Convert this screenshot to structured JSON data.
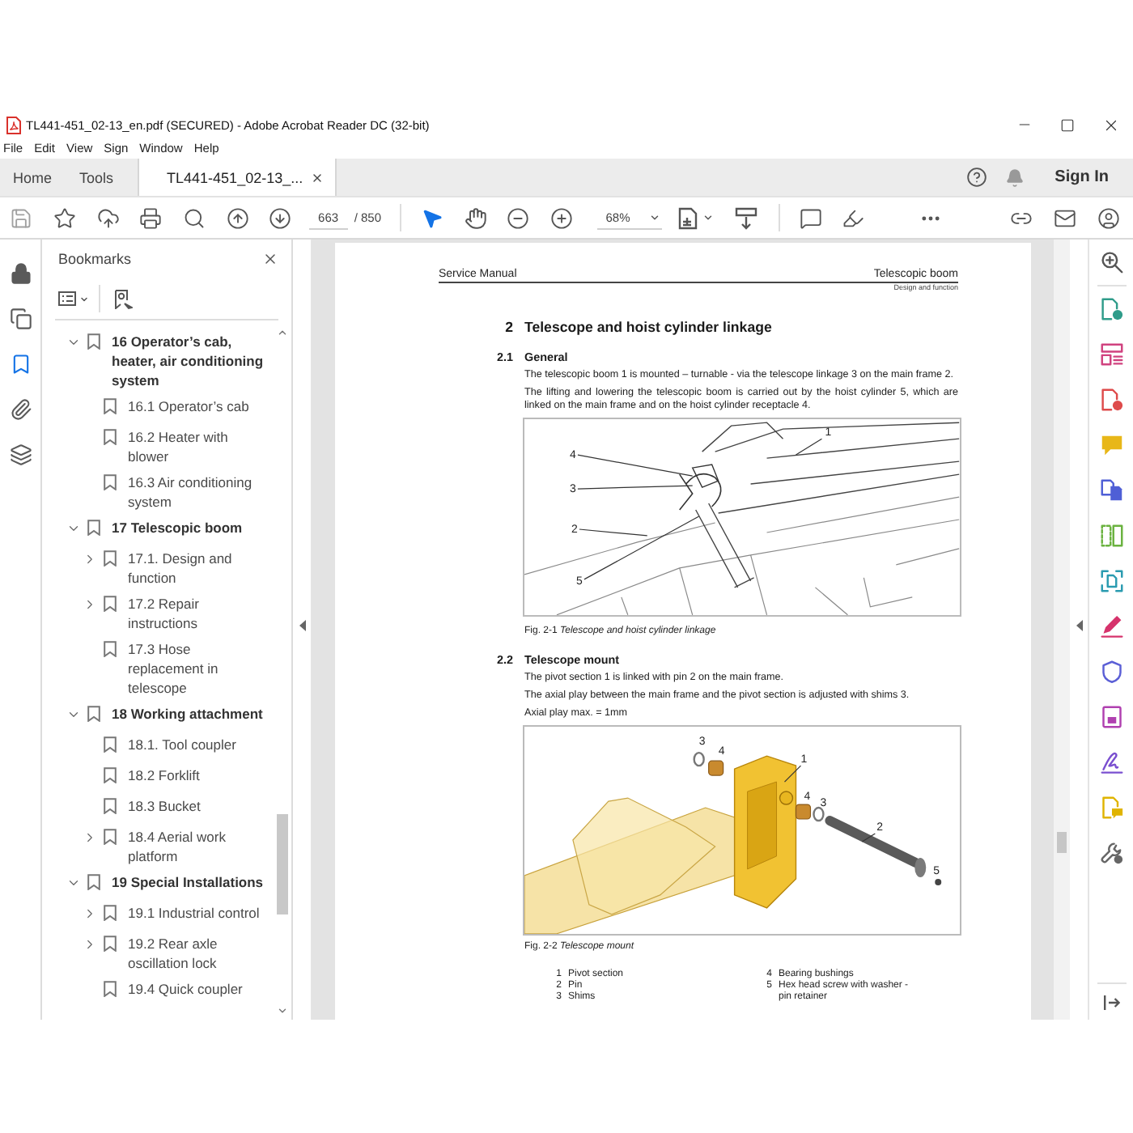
{
  "window": {
    "title": "TL441-451_02-13_en.pdf (SECURED) - Adobe Acrobat Reader DC (32-bit)"
  },
  "menu": [
    "File",
    "Edit",
    "View",
    "Sign",
    "Window",
    "Help"
  ],
  "tabs": [
    {
      "label": "Home",
      "selected": false
    },
    {
      "label": "Tools",
      "selected": false
    },
    {
      "label": "TL441-451_02-13_...",
      "selected": true,
      "closable": true
    }
  ],
  "account": {
    "sign_in": "Sign In"
  },
  "toolbar": {
    "page_current": "663",
    "page_total": "/ 850",
    "zoom": "68%",
    "tools": [
      {
        "kind": "select",
        "selected": true
      },
      {
        "kind": "hand",
        "selected": false
      }
    ]
  },
  "left_rail": [
    {
      "kind": "lock",
      "selected": false
    },
    {
      "kind": "pages",
      "selected": false
    },
    {
      "kind": "bookmarks",
      "selected": true
    },
    {
      "kind": "attachments",
      "selected": false
    },
    {
      "kind": "layers",
      "selected": false
    }
  ],
  "bookmarks": {
    "title": "Bookmarks",
    "items": [
      {
        "label": "16 Operator’s cab, heater, air conditioning system",
        "expanded": true,
        "children": [
          {
            "label": "16.1 Operator’s cab"
          },
          {
            "label": "16.2 Heater with blower"
          },
          {
            "label": "16.3 Air conditioning system"
          }
        ]
      },
      {
        "label": "17 Telescopic boom",
        "expanded": true,
        "children": [
          {
            "label": "17.1. Design and function",
            "expanded": false
          },
          {
            "label": "17.2 Repair instructions",
            "expanded": false
          },
          {
            "label": "17.3 Hose replacement in telescope"
          }
        ]
      },
      {
        "label": "18 Working attachment",
        "expanded": true,
        "children": [
          {
            "label": "18.1. Tool coupler"
          },
          {
            "label": "18.2 Forklift"
          },
          {
            "label": "18.3 Bucket"
          },
          {
            "label": "18.4 Aerial work platform",
            "expanded": false
          }
        ]
      },
      {
        "label": "19 Special Installations",
        "expanded": true,
        "children": [
          {
            "label": "19.1 Industrial control",
            "expanded": false
          },
          {
            "label": "19.2 Rear axle oscillation lock",
            "expanded": false
          },
          {
            "label": "19.4 Quick coupler"
          }
        ]
      }
    ]
  },
  "document": {
    "header": {
      "left": "Service Manual",
      "right": "Telescopic boom",
      "subtitle": "Design and function"
    },
    "heading": {
      "number": "2",
      "title": "Telescope and hoist cylinder linkage"
    },
    "sections": [
      {
        "number": "2.1",
        "title": "General",
        "paragraphs": [
          "The telescopic boom 1 is mounted – turnable - via the telescope linkage 3 on the main frame 2.",
          "The lifting and lowering the telescopic boom is carried out by the hoist cylinder 5, which are linked on the main frame and on the hoist cylinder receptacle 4."
        ],
        "figure": {
          "kind": "linkage",
          "callouts": [
            "1",
            "4",
            "3",
            "2",
            "5"
          ],
          "caption": "Fig. 2-1 *Telescope and hoist cylinder linkage*"
        }
      },
      {
        "number": "2.2",
        "title": "Telescope mount",
        "paragraphs": [
          "The pivot section 1 is linked with pin 2 on the main frame.",
          "The axial play between the main frame and the pivot section is adjusted with shims 3.",
          "Axial play max. = 1mm"
        ],
        "figure": {
          "kind": "mount",
          "callouts": [
            "3",
            "4",
            "1",
            "4",
            "3",
            "2",
            "5"
          ],
          "caption": "Fig. 2-2 *Telescope mount*"
        },
        "legend": [
          {
            "number": "1",
            "text": "Pivot section"
          },
          {
            "number": "2",
            "text": "Pin"
          },
          {
            "number": "3",
            "text": "Shims"
          },
          {
            "number": "4",
            "text": "Bearing bushings"
          },
          {
            "number": "5",
            "text": "Hex head screw with washer - pin retainer"
          }
        ]
      }
    ]
  }
}
